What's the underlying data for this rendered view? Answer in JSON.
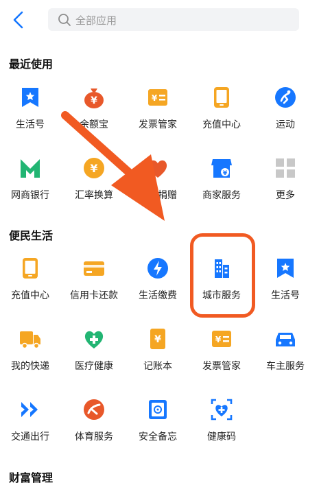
{
  "header": {
    "search_placeholder": "全部应用"
  },
  "sections": {
    "recent": {
      "title": "最近使用",
      "items": [
        "生活号",
        "余额宝",
        "发票管家",
        "充值中心",
        "运动",
        "网商银行",
        "汇率换算",
        "爱心捐赠",
        "商家服务",
        "更多"
      ]
    },
    "life": {
      "title": "便民生活",
      "items": [
        "充值中心",
        "信用卡还款",
        "生活缴费",
        "城市服务",
        "生活号",
        "我的快递",
        "医疗健康",
        "记账本",
        "发票管家",
        "车主服务",
        "交通出行",
        "体育服务",
        "安全备忘",
        "健康码"
      ]
    },
    "wealth": {
      "title": "财富管理"
    }
  },
  "colors": {
    "accent_blue": "#1677ff",
    "orange": "#f5a623",
    "annotation": "#f15a22"
  },
  "annotation": {
    "highlighted_item": "城市服务"
  }
}
